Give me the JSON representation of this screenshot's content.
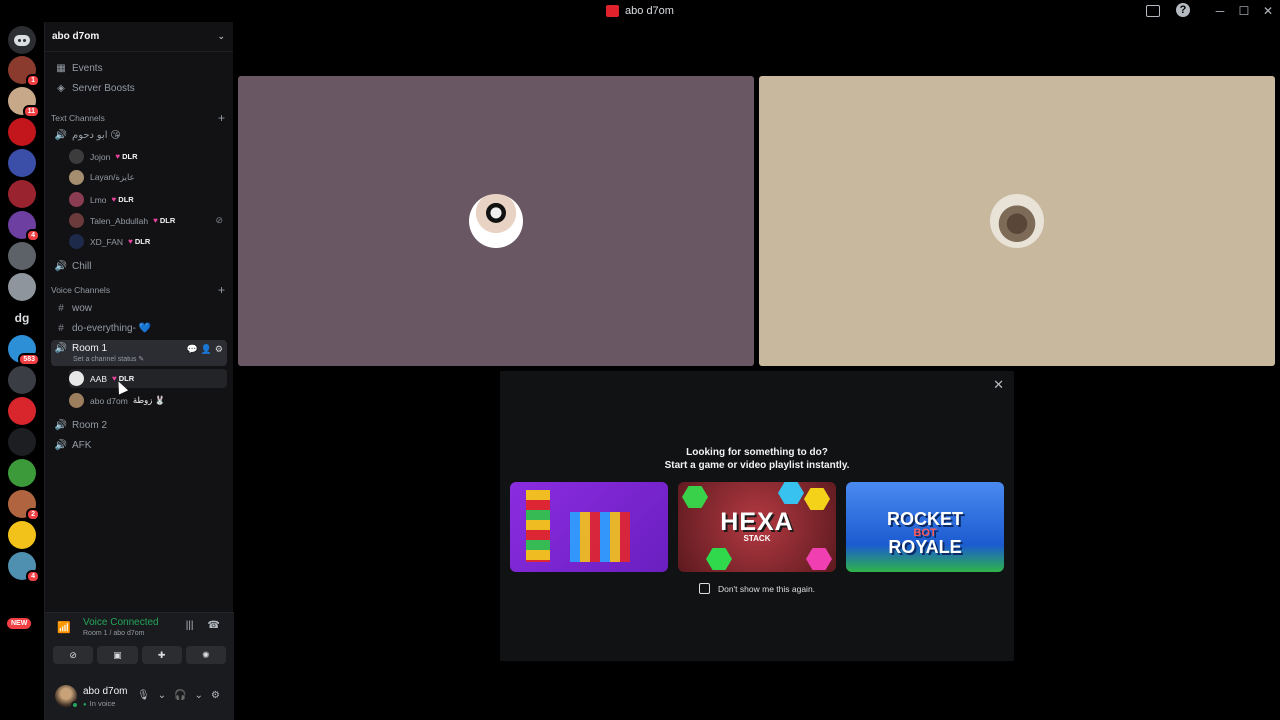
{
  "window": {
    "title": "abo d7om"
  },
  "server": {
    "name": "abo d7om"
  },
  "nav": {
    "events": "Events",
    "boosts": "Server Boosts"
  },
  "text_category": "Text Channels",
  "voice_category": "Voice Channels",
  "channels": {
    "arabic": "ابو دحوم 😘",
    "chill": "Chill",
    "wow": "wow",
    "do_everything": "do-everything- 💙",
    "room1": "Room 1",
    "room1_status": "Set a channel status ✎",
    "room2": "Room 2",
    "afk": "AFK"
  },
  "users_arabic": [
    {
      "name": "Jojon",
      "tag": "DLR"
    },
    {
      "name": "Layan/عايزة",
      "tag": ""
    },
    {
      "name": "Lmo",
      "tag": "DLR"
    },
    {
      "name": "Talen_Abdullah",
      "tag": "DLR"
    },
    {
      "name": "XD_FAN",
      "tag": "DLR"
    }
  ],
  "users_room1": [
    {
      "name": "AAB",
      "tag": "DLR"
    },
    {
      "name": "abo d7om",
      "tag": "زوطة 🐰"
    }
  ],
  "guild_badges": [
    "1",
    "11",
    "4",
    "7",
    "583",
    "2",
    "4"
  ],
  "guild_text": "dg",
  "new_label": "NEW",
  "voice": {
    "status": "Voice Connected",
    "location": "Room 1 / abo d7om"
  },
  "me": {
    "name": "abo d7om",
    "status": "In voice"
  },
  "activity": {
    "line1": "Looking for something to do?",
    "line2": "Start a game or video playlist instantly.",
    "hexa": "HEXA",
    "hexa_sub": "STACK",
    "rocket_1": "ROCKET",
    "rocket_2": "BOT",
    "rocket_3": "ROYALE",
    "dont_show": "Don't show me this again."
  }
}
